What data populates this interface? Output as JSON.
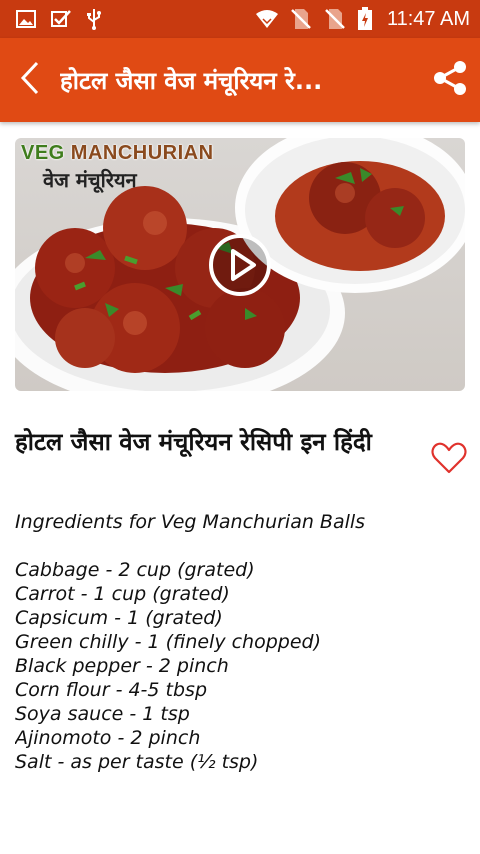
{
  "status_bar": {
    "time": "11:47 AM",
    "icons": [
      "image-icon",
      "check-icon",
      "usb-icon",
      "wifi-icon",
      "no-sim-icon",
      "no-sim-icon",
      "battery-charging-icon"
    ]
  },
  "app_bar": {
    "title": "होटल जैसा वेज मंचूरियन रे...",
    "back_icon": "back-arrow-icon",
    "share_icon": "share-icon"
  },
  "video": {
    "thumb_title_en_1": "VEG ",
    "thumb_title_en_2": "MANCHURIAN",
    "thumb_title_hi": "वेज मंचूरियन",
    "play_icon": "play-icon"
  },
  "recipe": {
    "title": "होटल जैसा वेज मंचूरियन रेसिपी इन हिंदी",
    "favorite_icon": "heart-outline-icon",
    "heading": "Ingredients for Veg Manchurian Balls",
    "ingredients": [
      "Cabbage - 2 cup (grated)",
      "Carrot - 1 cup (grated)",
      "Capsicum - 1 (grated)",
      "Green chilly - 1 (finely chopped)",
      "Black pepper - 2 pinch",
      "Corn flour - 4-5 tbsp",
      "Soya sauce - 1 tsp",
      "Ajinomoto - 2 pinch",
      "Salt - as per taste (½ tsp)"
    ]
  },
  "colors": {
    "status_bar": "#c83a10",
    "app_bar": "#e04a14",
    "heart": "#e0322c"
  }
}
